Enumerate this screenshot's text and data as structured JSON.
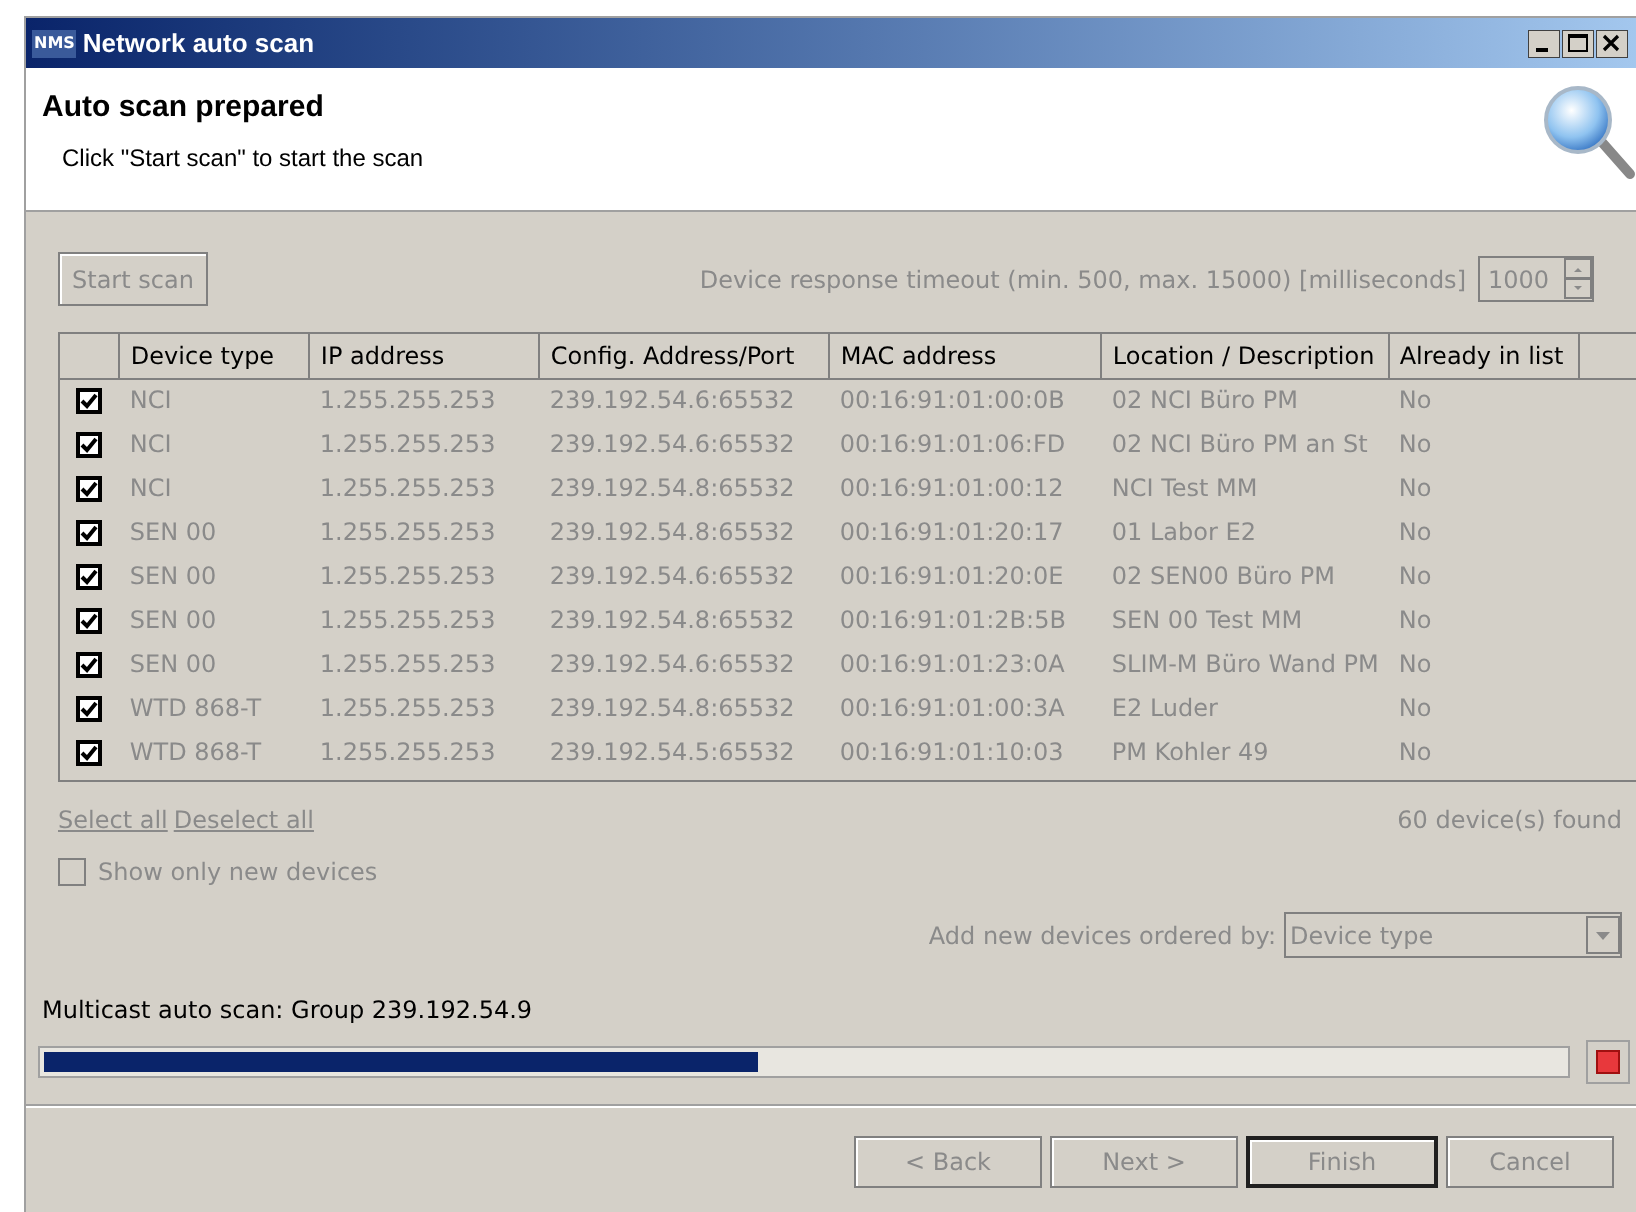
{
  "window": {
    "app_badge": "NMS",
    "title": "Network auto scan"
  },
  "header": {
    "title": "Auto scan prepared",
    "subtitle": "Click \"Start scan\" to start the scan"
  },
  "start_button": {
    "label": "Start scan",
    "disabled": true
  },
  "timeout": {
    "label": "Device response timeout (min. 500, max. 15000) [milliseconds]",
    "value": "1000",
    "disabled": true
  },
  "table": {
    "columns": [
      "Device type",
      "IP address",
      "Config. Address/Port",
      "MAC address",
      "Location / Description",
      "Already in list"
    ],
    "rows": [
      {
        "checked": true,
        "disabled": true,
        "cells": [
          "NCI",
          "1.255.255.253",
          "239.192.54.6:65532",
          "00:16:91:01:00:0B",
          "02 NCI Büro PM",
          "No"
        ]
      },
      {
        "checked": true,
        "disabled": true,
        "cells": [
          "NCI",
          "1.255.255.253",
          "239.192.54.6:65532",
          "00:16:91:01:06:FD",
          "02 NCI Büro PM an St",
          "No"
        ]
      },
      {
        "checked": true,
        "disabled": true,
        "cells": [
          "NCI",
          "1.255.255.253",
          "239.192.54.8:65532",
          "00:16:91:01:00:12",
          "NCI Test MM",
          "No"
        ]
      },
      {
        "checked": true,
        "disabled": true,
        "cells": [
          "SEN 00",
          "1.255.255.253",
          "239.192.54.8:65532",
          "00:16:91:01:20:17",
          "01 Labor E2",
          "No"
        ]
      },
      {
        "checked": true,
        "disabled": true,
        "cells": [
          "SEN 00",
          "1.255.255.253",
          "239.192.54.6:65532",
          "00:16:91:01:20:0E",
          "02 SEN00 Büro PM",
          "No"
        ]
      },
      {
        "checked": true,
        "disabled": true,
        "cells": [
          "SEN 00",
          "1.255.255.253",
          "239.192.54.8:65532",
          "00:16:91:01:2B:5B",
          "SEN 00 Test MM",
          "No"
        ]
      },
      {
        "checked": true,
        "disabled": true,
        "cells": [
          "SEN 00",
          "1.255.255.253",
          "239.192.54.6:65532",
          "00:16:91:01:23:0A",
          "SLIM-M Büro Wand PM",
          "No"
        ]
      },
      {
        "checked": true,
        "disabled": true,
        "cells": [
          "WTD 868-T",
          "1.255.255.253",
          "239.192.54.8:65532",
          "00:16:91:01:00:3A",
          "E2 Luder",
          "No"
        ]
      },
      {
        "checked": true,
        "disabled": true,
        "cells": [
          "WTD 868-T",
          "1.255.255.253",
          "239.192.54.5:65532",
          "00:16:91:01:10:03",
          "PM Kohler 49",
          "No"
        ]
      }
    ]
  },
  "links": [
    "Select all",
    "Deselect all"
  ],
  "found_count": "60 device(s) found",
  "show_only_new": {
    "label": "Show only new devices",
    "checked": false,
    "disabled": true
  },
  "order": {
    "label": "Add new devices ordered by:",
    "value": "Device type",
    "disabled": true
  },
  "status": "Multicast auto scan: Group 239.192.54.9",
  "progress": {
    "level": 0.47
  },
  "buttons": [
    {
      "label": "< Back",
      "disabled": true,
      "default": false
    },
    {
      "label": "Next >",
      "disabled": true,
      "default": false
    },
    {
      "label": "Finish",
      "disabled": true,
      "default": true
    },
    {
      "label": "Cancel",
      "disabled": true,
      "default": false
    }
  ]
}
